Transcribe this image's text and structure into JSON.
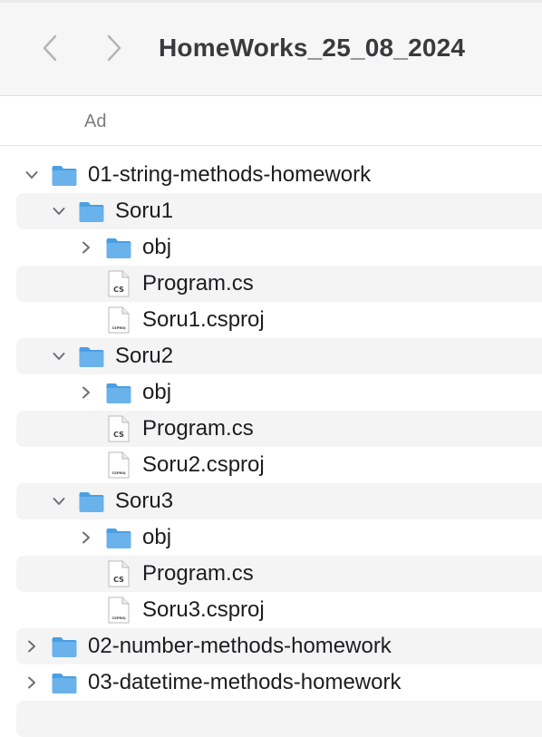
{
  "window": {
    "title": "HomeWorks_25_08_2024",
    "back_icon": "chevron-left-icon",
    "forward_icon": "chevron-right-icon"
  },
  "columns": {
    "name": "Ad"
  },
  "colors": {
    "folder": "#69b2ec",
    "row_alt": "#f4f4f5",
    "title": "#3a3a3c"
  },
  "tree": [
    {
      "label": "01-string-methods-homework",
      "type": "folder",
      "depth": 0,
      "expanded": true
    },
    {
      "label": "Soru1",
      "type": "folder",
      "depth": 1,
      "expanded": true
    },
    {
      "label": "obj",
      "type": "folder",
      "depth": 2,
      "expanded": false
    },
    {
      "label": "Program.cs",
      "type": "cs",
      "depth": 2,
      "icon_text": "CS"
    },
    {
      "label": "Soru1.csproj",
      "type": "csproj",
      "depth": 2,
      "icon_text": "CSPROJ"
    },
    {
      "label": "Soru2",
      "type": "folder",
      "depth": 1,
      "expanded": true
    },
    {
      "label": "obj",
      "type": "folder",
      "depth": 2,
      "expanded": false
    },
    {
      "label": "Program.cs",
      "type": "cs",
      "depth": 2,
      "icon_text": "CS"
    },
    {
      "label": "Soru2.csproj",
      "type": "csproj",
      "depth": 2,
      "icon_text": "CSPROJ"
    },
    {
      "label": "Soru3",
      "type": "folder",
      "depth": 1,
      "expanded": true
    },
    {
      "label": "obj",
      "type": "folder",
      "depth": 2,
      "expanded": false
    },
    {
      "label": "Program.cs",
      "type": "cs",
      "depth": 2,
      "icon_text": "CS"
    },
    {
      "label": "Soru3.csproj",
      "type": "csproj",
      "depth": 2,
      "icon_text": "CSPROJ"
    },
    {
      "label": "02-number-methods-homework",
      "type": "folder",
      "depth": 0,
      "expanded": false
    },
    {
      "label": "03-datetime-methods-homework",
      "type": "folder",
      "depth": 0,
      "expanded": false
    }
  ]
}
